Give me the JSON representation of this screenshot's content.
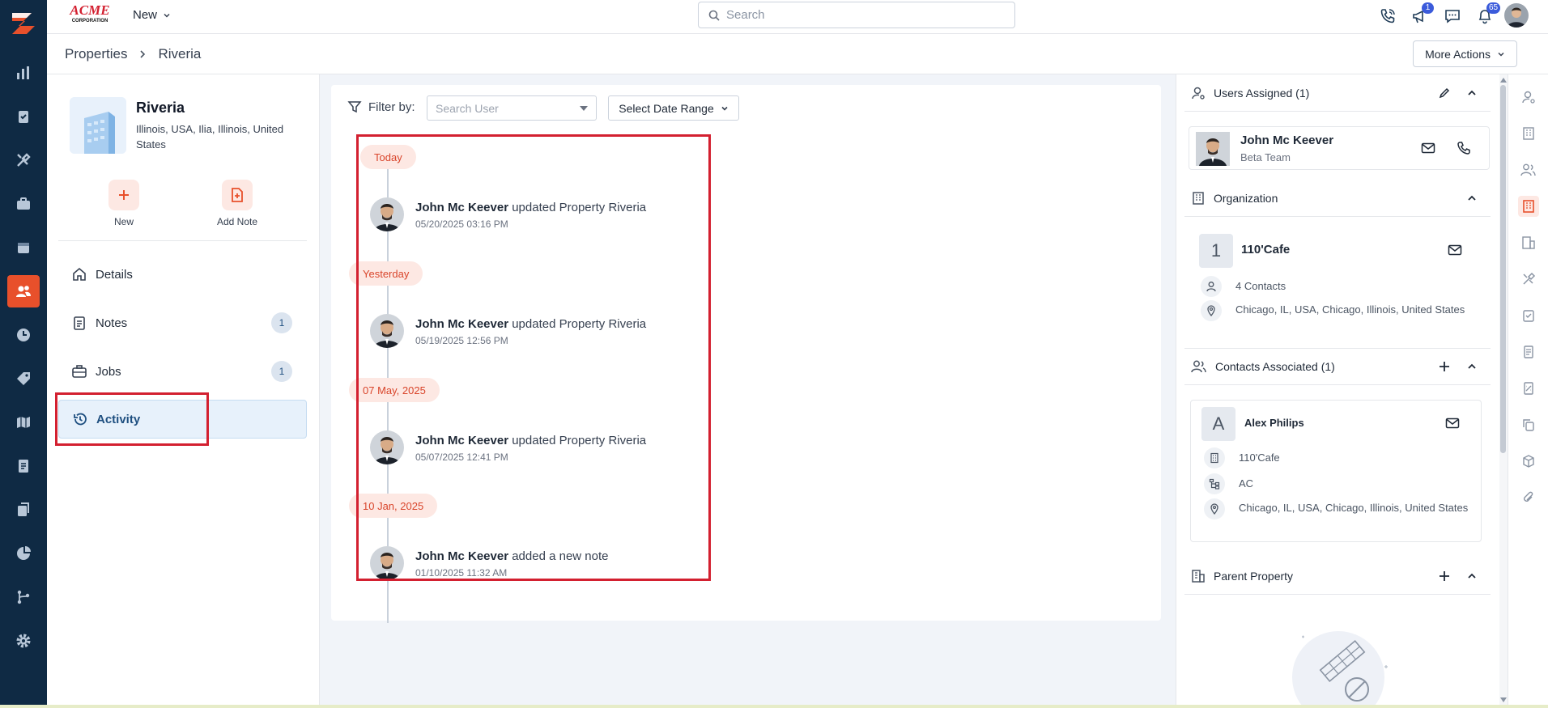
{
  "app": {
    "brand": "ACME CORPORATION",
    "new_label": "New"
  },
  "search": {
    "placeholder": "Search"
  },
  "topbar": {
    "announcements_badge": "1",
    "notifications_badge": "65"
  },
  "breadcrumb": {
    "parent": "Properties",
    "current": "Riveria"
  },
  "more_actions": "More Actions",
  "property": {
    "name": "Riveria",
    "address": "Illinois, USA, Ilia, Illinois, United States"
  },
  "quick_actions": {
    "new": "New",
    "add_note": "Add Note"
  },
  "menu": [
    {
      "label": "Details",
      "count": ""
    },
    {
      "label": "Notes",
      "count": "1"
    },
    {
      "label": "Jobs",
      "count": "1"
    },
    {
      "label": "Activity",
      "count": ""
    }
  ],
  "filter": {
    "label": "Filter by:",
    "user_placeholder": "Search User",
    "date_range": "Select Date Range"
  },
  "activity": {
    "groups": [
      {
        "date": "Today",
        "user": "John Mc Keever",
        "action": "updated Property Riveria",
        "time": "05/20/2025 03:16 PM"
      },
      {
        "date": "Yesterday",
        "user": "John Mc Keever",
        "action": "updated Property Riveria",
        "time": "05/19/2025 12:56 PM"
      },
      {
        "date": "07 May, 2025",
        "user": "John Mc Keever",
        "action": "updated Property Riveria",
        "time": "05/07/2025 12:41 PM"
      },
      {
        "date": "10 Jan, 2025",
        "user": "John Mc Keever",
        "action": "added a new note",
        "time": "01/10/2025 11:32 AM"
      }
    ]
  },
  "users_assigned": {
    "title": "Users Assigned (1)",
    "name": "John Mc Keever",
    "team": "Beta Team"
  },
  "organization": {
    "title": "Organization",
    "initial": "1",
    "name": "110'Cafe",
    "contacts": "4 Contacts",
    "address": "Chicago, IL, USA, Chicago, Illinois, United States"
  },
  "contacts_associated": {
    "title": "Contacts Associated (1)",
    "initial": "A",
    "name": "Alex Philips",
    "org": "110'Cafe",
    "type": "AC",
    "address": "Chicago, IL, USA, Chicago, Illinois, United States"
  },
  "parent_property": {
    "title": "Parent Property"
  },
  "colors": {
    "brand": "#e8502b",
    "sidebar": "#0f2a44",
    "highlight_box": "#d32030",
    "active_menu": "#e7f1fb"
  }
}
